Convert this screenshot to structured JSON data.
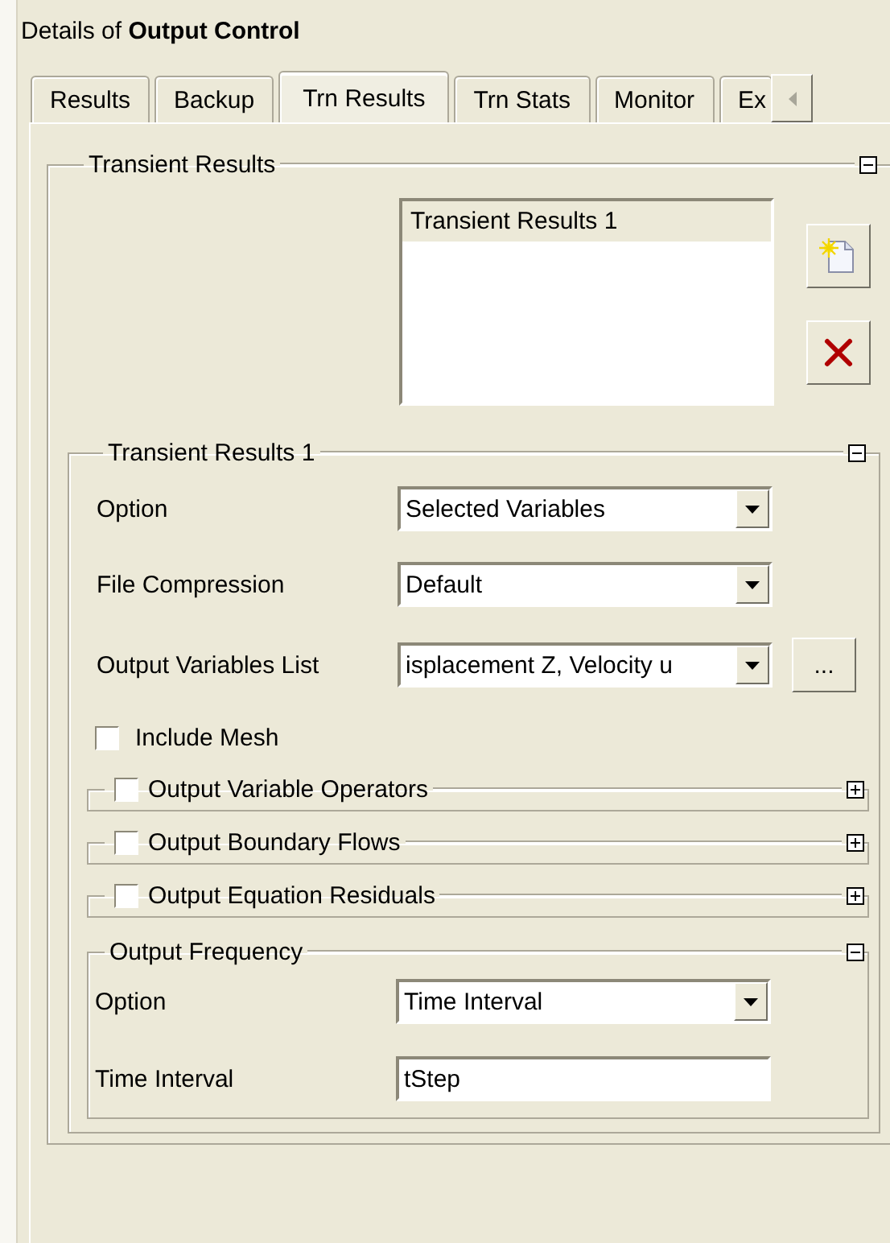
{
  "header": {
    "title": "Details of **Output Control**"
  },
  "tabs": [
    {
      "label": "Results",
      "selected": false
    },
    {
      "label": "Backup",
      "selected": false
    },
    {
      "label": "Trn Results",
      "selected": true
    },
    {
      "label": "Trn Stats",
      "selected": false
    },
    {
      "label": "Monitor",
      "selected": false
    },
    {
      "label": "Ex",
      "selected": false
    }
  ],
  "group": {
    "title": "Transient Results",
    "expanded": true,
    "list": [
      {
        "label": "Transient Results 1",
        "selected": true
      }
    ],
    "subgroup": {
      "title": "Transient Results 1",
      "expanded": true,
      "fields": [
        {
          "kind": "select",
          "label": "Option",
          "value": "Selected Variables"
        },
        {
          "kind": "select",
          "label": "File Compression",
          "value": "Default"
        },
        {
          "kind": "select_more",
          "label": "Output Variables List",
          "value": "isplacement Z, Velocity u",
          "more": "..."
        }
      ],
      "include_mesh": {
        "label": "Include Mesh",
        "checked": false
      },
      "sections": [
        {
          "title": "Output Variable Operators",
          "checked": false,
          "expanded": false
        },
        {
          "title": "Output Boundary Flows",
          "checked": false,
          "expanded": false
        },
        {
          "title": "Output Equation Residuals",
          "checked": false,
          "expanded": false
        }
      ],
      "frequency": {
        "title": "Output Frequency",
        "expanded": true,
        "fields": [
          {
            "kind": "select",
            "label": "Option",
            "value": "Time Interval"
          },
          {
            "kind": "text",
            "label": "Time Interval",
            "value": "tStep"
          }
        ]
      }
    }
  }
}
